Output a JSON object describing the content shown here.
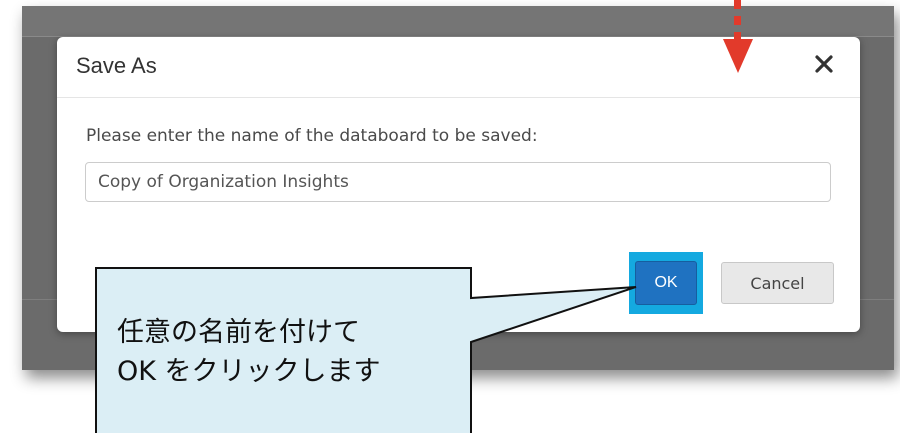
{
  "dialog": {
    "title": "Save As",
    "close_icon": "close-icon",
    "prompt_label": "Please enter the name of the databoard to be saved:",
    "name_input_value": "Copy of Organization Insights",
    "ok_label": "OK",
    "cancel_label": "Cancel"
  },
  "annotation": {
    "callout_line1": "任意の名前を付けて",
    "callout_line2": "OK をクリックします",
    "arrow_icon": "down-arrow-icon"
  },
  "colors": {
    "ok_button": "#1f72c1",
    "ok_highlight": "#14a9e0",
    "callout_fill": "#dbeef5",
    "arrow": "#e23a2b"
  }
}
